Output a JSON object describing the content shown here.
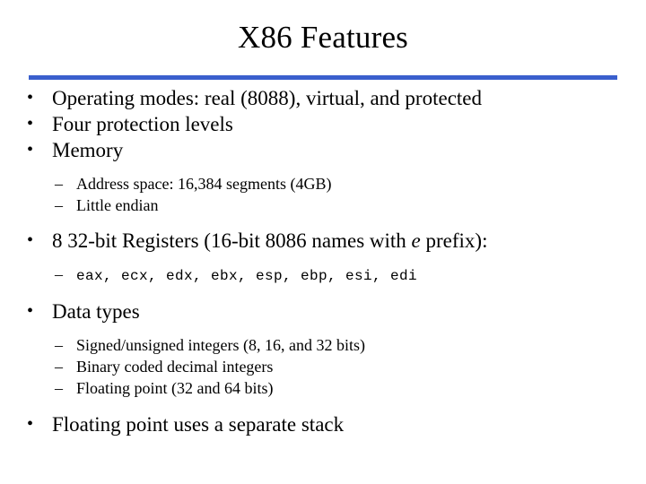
{
  "slide": {
    "title": "X86 Features",
    "accent_color": "#3a5fcd",
    "background_color": "#ffffff",
    "text_color": "#000000",
    "bullet_marker": "•",
    "subbullet_marker": "–",
    "outline": [
      {
        "level": 1,
        "text": "Operating modes: real (8088), virtual, and protected"
      },
      {
        "level": 1,
        "text": "Four protection levels"
      },
      {
        "level": 1,
        "text": "Memory"
      },
      {
        "level": 2,
        "text": "Address space: 16,384 segments (4GB)"
      },
      {
        "level": 2,
        "text": "Little endian"
      },
      {
        "level": 1,
        "text_part_1": "8 32-bit Registers (16-bit 8086 names with ",
        "text_italic": "e",
        "text_part_2": " prefix):"
      },
      {
        "level": 2,
        "style": "monospace",
        "text": "eax, ecx, edx, ebx, esp, ebp, esi, edi"
      },
      {
        "level": 1,
        "text": "Data types"
      },
      {
        "level": 2,
        "text": "Signed/unsigned integers (8, 16, and 32 bits)"
      },
      {
        "level": 2,
        "text": "Binary coded decimal integers"
      },
      {
        "level": 2,
        "text": "Floating point (32 and 64 bits)"
      },
      {
        "level": 1,
        "text": "Floating point uses a separate stack"
      }
    ]
  }
}
